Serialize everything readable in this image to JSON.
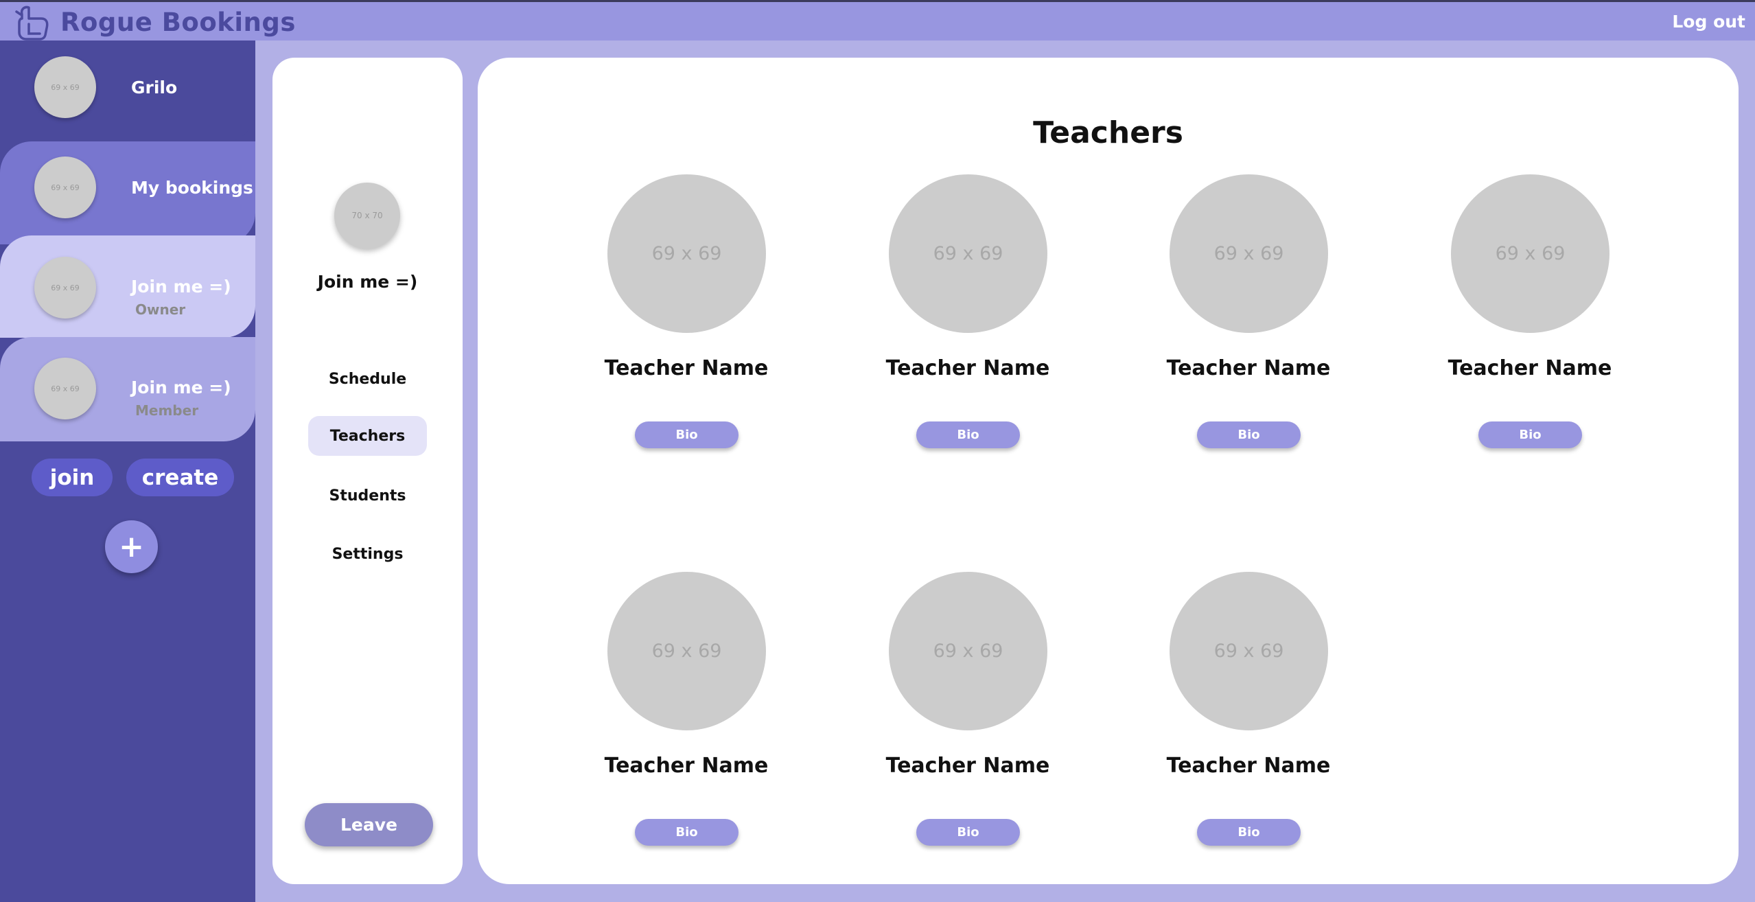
{
  "app": {
    "title": "Rogue Bookings",
    "logout_label": "Log out"
  },
  "rail": {
    "items": [
      {
        "avatar_text": "69 x 69",
        "title": "Grilo",
        "subtitle": ""
      },
      {
        "avatar_text": "69 x 69",
        "title": "My bookings",
        "subtitle": ""
      },
      {
        "avatar_text": "69 x 69",
        "title": "Join me =)",
        "subtitle": "Owner"
      },
      {
        "avatar_text": "69 x 69",
        "title": "Join me =)",
        "subtitle": "Member"
      }
    ],
    "join_label": "join",
    "create_label": "create",
    "plus_label": "+"
  },
  "group": {
    "avatar_text": "70 x 70",
    "name": "Join me =)",
    "nav": [
      {
        "label": "Schedule",
        "active": false
      },
      {
        "label": "Teachers",
        "active": true
      },
      {
        "label": "Students",
        "active": false
      },
      {
        "label": "Settings",
        "active": false
      }
    ],
    "leave_label": "Leave"
  },
  "main": {
    "title": "Teachers",
    "teachers": [
      {
        "avatar_text": "69 x 69",
        "name": "Teacher Name",
        "bio_label": "Bio"
      },
      {
        "avatar_text": "69 x 69",
        "name": "Teacher Name",
        "bio_label": "Bio"
      },
      {
        "avatar_text": "69 x 69",
        "name": "Teacher Name",
        "bio_label": "Bio"
      },
      {
        "avatar_text": "69 x 69",
        "name": "Teacher Name",
        "bio_label": "Bio"
      },
      {
        "avatar_text": "69 x 69",
        "name": "Teacher Name",
        "bio_label": "Bio"
      },
      {
        "avatar_text": "69 x 69",
        "name": "Teacher Name",
        "bio_label": "Bio"
      },
      {
        "avatar_text": "69 x 69",
        "name": "Teacher Name",
        "bio_label": "Bio"
      }
    ]
  },
  "colors": {
    "accent": "#9896e0",
    "rail_dark": "#4b4a9c",
    "brand_text": "#4b4a9e",
    "background": "#b2b0e6"
  }
}
